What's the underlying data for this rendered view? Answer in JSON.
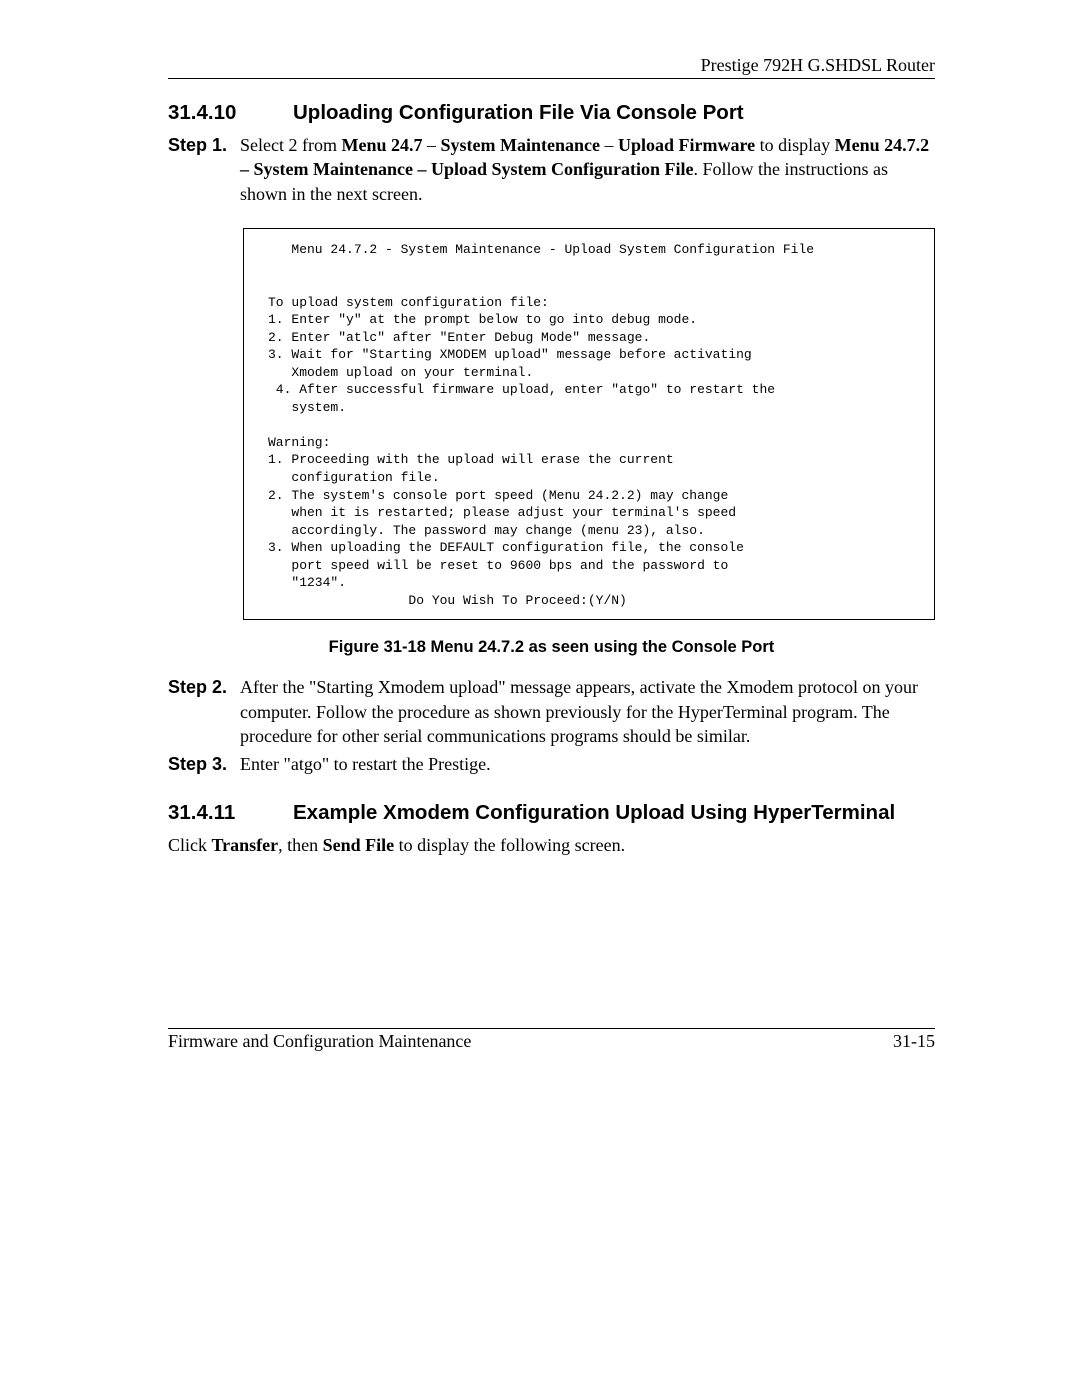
{
  "header": {
    "product": "Prestige 792H G.SHDSL Router"
  },
  "section1": {
    "number": "31.4.10",
    "title": "Uploading Configuration File Via Console Port"
  },
  "step1": {
    "label": "Step 1.",
    "pre": "Select 2 from ",
    "b1": "Menu 24.7",
    "s1": " – ",
    "b2": "System Maintenance",
    "s2": " – ",
    "b3": "Upload Firmware",
    "s3": " to display ",
    "b4": "Menu 24.7.2 – System Maintenance – Upload System Configuration File",
    "post": ". Follow the instructions as shown in the next screen."
  },
  "console": "   Menu 24.7.2 - System Maintenance - Upload System Configuration File\n\n\nTo upload system configuration file:\n1. Enter \"y\" at the prompt below to go into debug mode.\n2. Enter \"atlc\" after \"Enter Debug Mode\" message.\n3. Wait for \"Starting XMODEM upload\" message before activating\n   Xmodem upload on your terminal.\n 4. After successful firmware upload, enter \"atgo\" to restart the\n   system.\n\nWarning:\n1. Proceeding with the upload will erase the current\n   configuration file.\n2. The system's console port speed (Menu 24.2.2) may change\n   when it is restarted; please adjust your terminal's speed\n   accordingly. The password may change (menu 23), also.\n3. When uploading the DEFAULT configuration file, the console\n   port speed will be reset to 9600 bps and the password to\n   \"1234\".\n                  Do You Wish To Proceed:(Y/N)",
  "figure": {
    "caption": "Figure 31-18 Menu 24.7.2 as seen using the Console Port"
  },
  "step2": {
    "label": "Step 2.",
    "text": "After the \"Starting Xmodem upload\" message appears, activate the Xmodem protocol on your computer. Follow the procedure as shown previously for the HyperTerminal program. The procedure for other serial communications programs should be similar."
  },
  "step3": {
    "label": "Step 3.",
    "text": "Enter \"atgo\" to restart the Prestige."
  },
  "section2": {
    "number": "31.4.11",
    "title": "Example Xmodem Configuration Upload Using HyperTerminal"
  },
  "para2": {
    "pre": "Click ",
    "b1": "Transfer",
    "mid": ", then ",
    "b2": "Send File",
    "post": " to display the following screen."
  },
  "footer": {
    "left": "Firmware and Configuration Maintenance",
    "right": "31-15"
  }
}
